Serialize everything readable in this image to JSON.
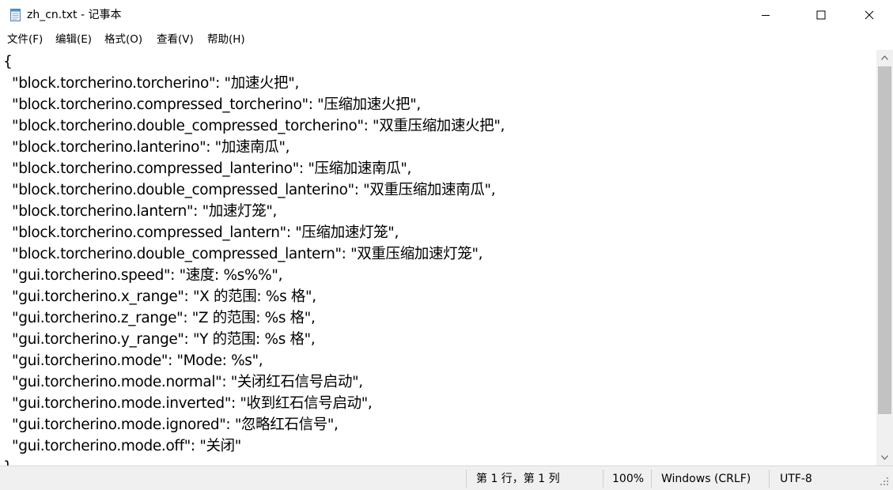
{
  "window": {
    "title": "zh_cn.txt - 记事本"
  },
  "menu": [
    {
      "label": "文件(F)"
    },
    {
      "label": "编辑(E)"
    },
    {
      "label": "格式(O)"
    },
    {
      "label": "查看(V)"
    },
    {
      "label": "帮助(H)"
    }
  ],
  "editor": {
    "lines": [
      "{",
      "  \"block.torcherino.torcherino\": \"加速火把\",",
      "  \"block.torcherino.compressed_torcherino\": \"压缩加速火把\",",
      "  \"block.torcherino.double_compressed_torcherino\": \"双重压缩加速火把\",",
      "  \"block.torcherino.lanterino\": \"加速南瓜\",",
      "  \"block.torcherino.compressed_lanterino\": \"压缩加速南瓜\",",
      "  \"block.torcherino.double_compressed_lanterino\": \"双重压缩加速南瓜\",",
      "  \"block.torcherino.lantern\": \"加速灯笼\",",
      "  \"block.torcherino.compressed_lantern\": \"压缩加速灯笼\",",
      "  \"block.torcherino.double_compressed_lantern\": \"双重压缩加速灯笼\",",
      "  \"gui.torcherino.speed\": \"速度: %s%%\",",
      "  \"gui.torcherino.x_range\": \"X 的范围: %s 格\",",
      "  \"gui.torcherino.z_range\": \"Z 的范围: %s 格\",",
      "  \"gui.torcherino.y_range\": \"Y 的范围: %s 格\",",
      "  \"gui.torcherino.mode\": \"Mode: %s\",",
      "  \"gui.torcherino.mode.normal\": \"关闭红石信号启动\",",
      "  \"gui.torcherino.mode.inverted\": \"收到红石信号启动\",",
      "  \"gui.torcherino.mode.ignored\": \"忽略红石信号\",",
      "  \"gui.torcherino.mode.off\": \"关闭\"",
      "}"
    ]
  },
  "status": {
    "position": "第 1 行，第 1 列",
    "zoom": "100%",
    "line_ending": "Windows (CRLF)",
    "encoding": "UTF-8"
  },
  "icons": {
    "app": "notepad-icon",
    "minimize": "minimize-icon",
    "maximize": "maximize-icon",
    "close": "close-icon"
  }
}
